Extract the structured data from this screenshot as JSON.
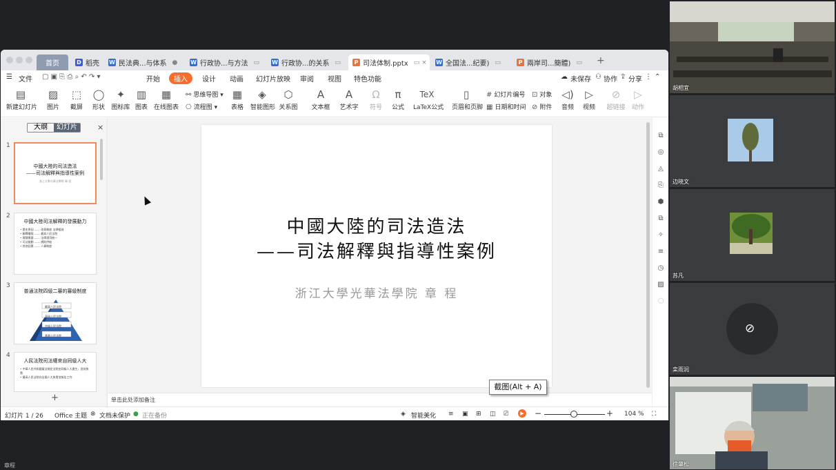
{
  "window": {
    "home_tab": "首页",
    "tabs": [
      {
        "label": "稻壳",
        "icon_color": "#3b5bdb",
        "icon_letter": "D",
        "pin": ""
      },
      {
        "label": "民法典...与体系",
        "icon_color": "#2f6fd6",
        "icon_letter": "W",
        "pin": "●"
      },
      {
        "label": "行政协...与方法",
        "icon_color": "#2f6fd6",
        "icon_letter": "W",
        "pin": "▭"
      },
      {
        "label": "行政协...的关系",
        "icon_color": "#2f6fd6",
        "icon_letter": "W",
        "pin": "▭"
      },
      {
        "label": "司法体制.pptx",
        "icon_color": "#e8743b",
        "icon_letter": "P",
        "pin": "▭  ×"
      },
      {
        "label": "全国法...纪要)",
        "icon_color": "#2f6fd6",
        "icon_letter": "W",
        "pin": "▭"
      },
      {
        "label": "兩岸司...簡體)",
        "icon_color": "#e8743b",
        "icon_letter": "P",
        "pin": "▭"
      }
    ],
    "new_tab": "+"
  },
  "menubar": {
    "file": "文件",
    "items": [
      "开始",
      "插入",
      "设计",
      "动画",
      "幻灯片放映",
      "审阅",
      "视图",
      "特色功能"
    ],
    "active": "插入",
    "unsaved": "未保存",
    "collab": "协作",
    "share": "分享"
  },
  "ribbon": {
    "buttons": [
      {
        "label": "新建幻灯片",
        "icon": "▤"
      },
      {
        "label": "图片",
        "icon": "▨"
      },
      {
        "label": "截屏",
        "icon": "⬚"
      },
      {
        "label": "形状",
        "icon": "◯"
      },
      {
        "label": "图标库",
        "icon": "✦"
      },
      {
        "label": "图表",
        "icon": "▥"
      },
      {
        "label": "在线图表",
        "icon": "▦"
      },
      {
        "label": "表格",
        "icon": "▦"
      },
      {
        "label": "智能图形",
        "icon": "◈"
      },
      {
        "label": "关系图",
        "icon": "⬡"
      },
      {
        "label": "文本框",
        "icon": "A"
      },
      {
        "label": "艺术字",
        "icon": "A"
      },
      {
        "label": "符号",
        "icon": "Ω"
      },
      {
        "label": "公式",
        "icon": "π"
      },
      {
        "label": "LaTeX公式",
        "icon": "TeX"
      },
      {
        "label": "页眉和页脚",
        "icon": "▯"
      },
      {
        "label": "音频",
        "icon": "◁)"
      },
      {
        "label": "视频",
        "icon": "▷"
      },
      {
        "label": "超链接",
        "icon": "⊘"
      },
      {
        "label": "动作",
        "icon": "▷"
      }
    ],
    "mindmap": "思维导图",
    "flowchart": "流程图",
    "slide_number": "幻灯片编号",
    "object": "对象",
    "datetime": "日期和时间",
    "attachment": "附件"
  },
  "leftpane": {
    "outline_tab": "大纲",
    "slides_tab": "幻灯片",
    "close": "×",
    "add": "+",
    "thumbnails": [
      {
        "num": "1",
        "title": "中國大陸的司法造法",
        "subtitle": "——司法解釋與指導性案例",
        "body": "浙江大學光華法學院 章 程"
      },
      {
        "num": "2",
        "title": "中國大陸司法解釋的發展動力",
        "subtitle": "",
        "body": "• 歷史原因 —— 改革開放 法律粗疏\n• 解釋權限 —— 最高人民法院\n• 實踐需要 —— 法律適用統一\n• 司法能動 —— 規則供給\n• 其他因素 —— 人事制度"
      },
      {
        "num": "3",
        "title": "普通法院四級二審的審級制度",
        "subtitle": "",
        "body": "最高人民法院\n高級人民法院\n中級人民法院\n基層人民法院"
      },
      {
        "num": "4",
        "title": "人民法院司法權來自同級人大",
        "subtitle": "",
        "body": "• 中華人民共和國憲法規定法院由同級人大產生，對其負責\n• 最高人民法院向全國人大負責並報告工作"
      }
    ]
  },
  "slide": {
    "title_line1": "中國大陸的司法造法",
    "title_line2": "——司法解釋與指導性案例",
    "author": "浙江大學光華法學院 章 程"
  },
  "notes_placeholder": "单击此处添加备注",
  "statusbar": {
    "slide_counter": "幻灯片 1 / 26",
    "theme": "Office 主题",
    "protect": "文档未保护",
    "backup": "正在备份",
    "beautify": "智能美化",
    "zoom_level": "104 %"
  },
  "tooltip": "截图(Alt + A)",
  "participants": [
    {
      "name": "胡相宜"
    },
    {
      "name": "边晓文"
    },
    {
      "name": "苏凡"
    },
    {
      "name": "栾雨润"
    },
    {
      "name": "徐肇松"
    }
  ],
  "self_name": "章程"
}
